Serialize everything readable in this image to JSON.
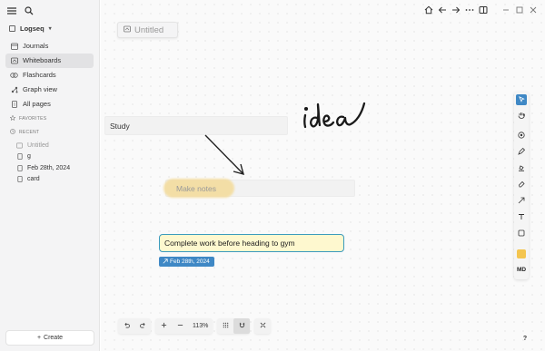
{
  "sidebar": {
    "graph_name": "Logseq",
    "graph_caret": "▾",
    "nav": [
      {
        "label": "Journals",
        "icon": "calendar-icon"
      },
      {
        "label": "Whiteboards",
        "icon": "whiteboard-icon",
        "active": true
      },
      {
        "label": "Flashcards",
        "icon": "flashcards-icon"
      },
      {
        "label": "Graph view",
        "icon": "graph-icon"
      },
      {
        "label": "All pages",
        "icon": "pages-icon"
      }
    ],
    "favorites_label": "FAVORITES",
    "recent_label": "RECENT",
    "recent": [
      {
        "label": "Untitled",
        "icon": "whiteboard-icon"
      },
      {
        "label": "g",
        "icon": "page-icon"
      },
      {
        "label": "Feb 28th, 2024",
        "icon": "page-icon"
      },
      {
        "label": "card",
        "icon": "page-icon"
      }
    ],
    "create_label": "Create",
    "create_icon": "+"
  },
  "whiteboard": {
    "title": "Untitled",
    "shapes": {
      "study": "Study",
      "make_notes": "Make notes",
      "task": "Complete work before heading to gym",
      "date_tag": "Feb 28th, 2024"
    },
    "highlight_color": "#f4d88d",
    "handwriting": "idea"
  },
  "toolbar": {
    "active_tool": "select",
    "swatch_color": "#f4c54f",
    "md_label": "MD",
    "zoom": "113%"
  },
  "colors": {
    "accent": "#3f88c5",
    "task_fill": "#fef8cf",
    "task_border": "#3b9bbd"
  },
  "help_label": "?"
}
